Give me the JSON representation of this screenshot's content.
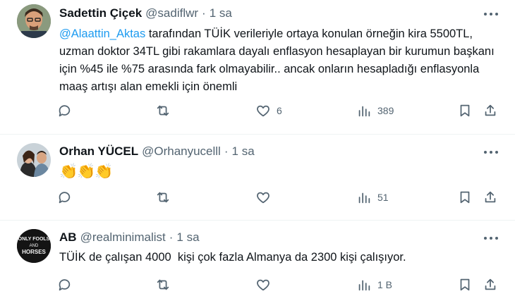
{
  "tweets": [
    {
      "name": "Sadettin Çiçek",
      "handle": "@sadiflwr",
      "separator": "·",
      "time": "1 sa",
      "mention": "@Alaattin_Aktas",
      "text_after_mention": " tarafından TÜİK verileriyle ortaya konulan örneğin kira 5500TL, uzman doktor 34TL gibi rakamlara dayalı enflasyon hesaplayan bir kurumun başkanı için %45 ile %75 arasında fark olmayabilir.. ancak onların hesapladığı enflasyonla maaş artışı alan emekli için önemli",
      "likes": "6",
      "views": "389",
      "avatar_icon": "avatar-man-photo"
    },
    {
      "name": "Orhan YÜCEL",
      "handle": "@Orhanyucelll",
      "separator": "·",
      "time": "1 sa",
      "text": "👏👏👏",
      "views": "51",
      "avatar_icon": "avatar-couple-photo"
    },
    {
      "name": "AB",
      "handle": "@realminimalist",
      "separator": "·",
      "time": "1 sa",
      "text": "TÜİK de çalışan 4000  kişi çok fazla Almanya da 2300 kişi çalışıyor.",
      "views": "1 B",
      "avatar_icon": "avatar-only-fools-and-horses-logo",
      "avatar_lines": [
        "ONLY FOOLS",
        "AND",
        "HORSES"
      ]
    }
  ],
  "colors": {
    "text": "#0f1419",
    "secondary": "#536471",
    "link": "#1d9bf0",
    "divider": "#eff3f4"
  }
}
